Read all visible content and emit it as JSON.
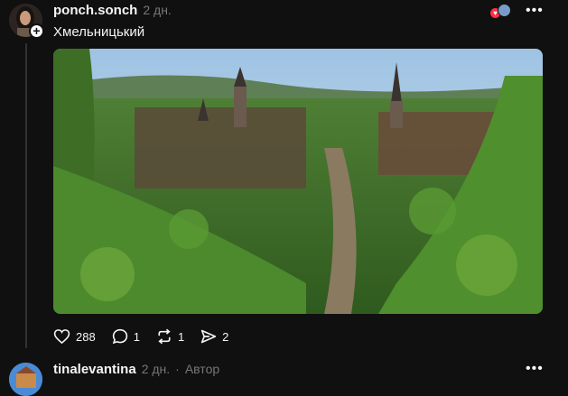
{
  "post": {
    "username": "ponch.sonch",
    "time": "2 дн.",
    "caption": "Хмельницький",
    "follow_symbol": "+",
    "more_symbol": "•••",
    "photo_alt": "",
    "actions": {
      "likes": "288",
      "comments": "1",
      "reposts": "1",
      "shares": "2"
    }
  },
  "next_post": {
    "username": "tinalevantina",
    "time": "2 дн.",
    "author_sep": "·",
    "author_label": "Автор",
    "more_symbol": "•••"
  },
  "colors": {
    "background": "#101010",
    "text": "#f3f5f7",
    "muted": "#777777",
    "like_red": "#ff3040"
  },
  "icons": [
    "plus-icon",
    "heart-icon",
    "comment-icon",
    "repost-icon",
    "share-icon",
    "more-icon"
  ]
}
